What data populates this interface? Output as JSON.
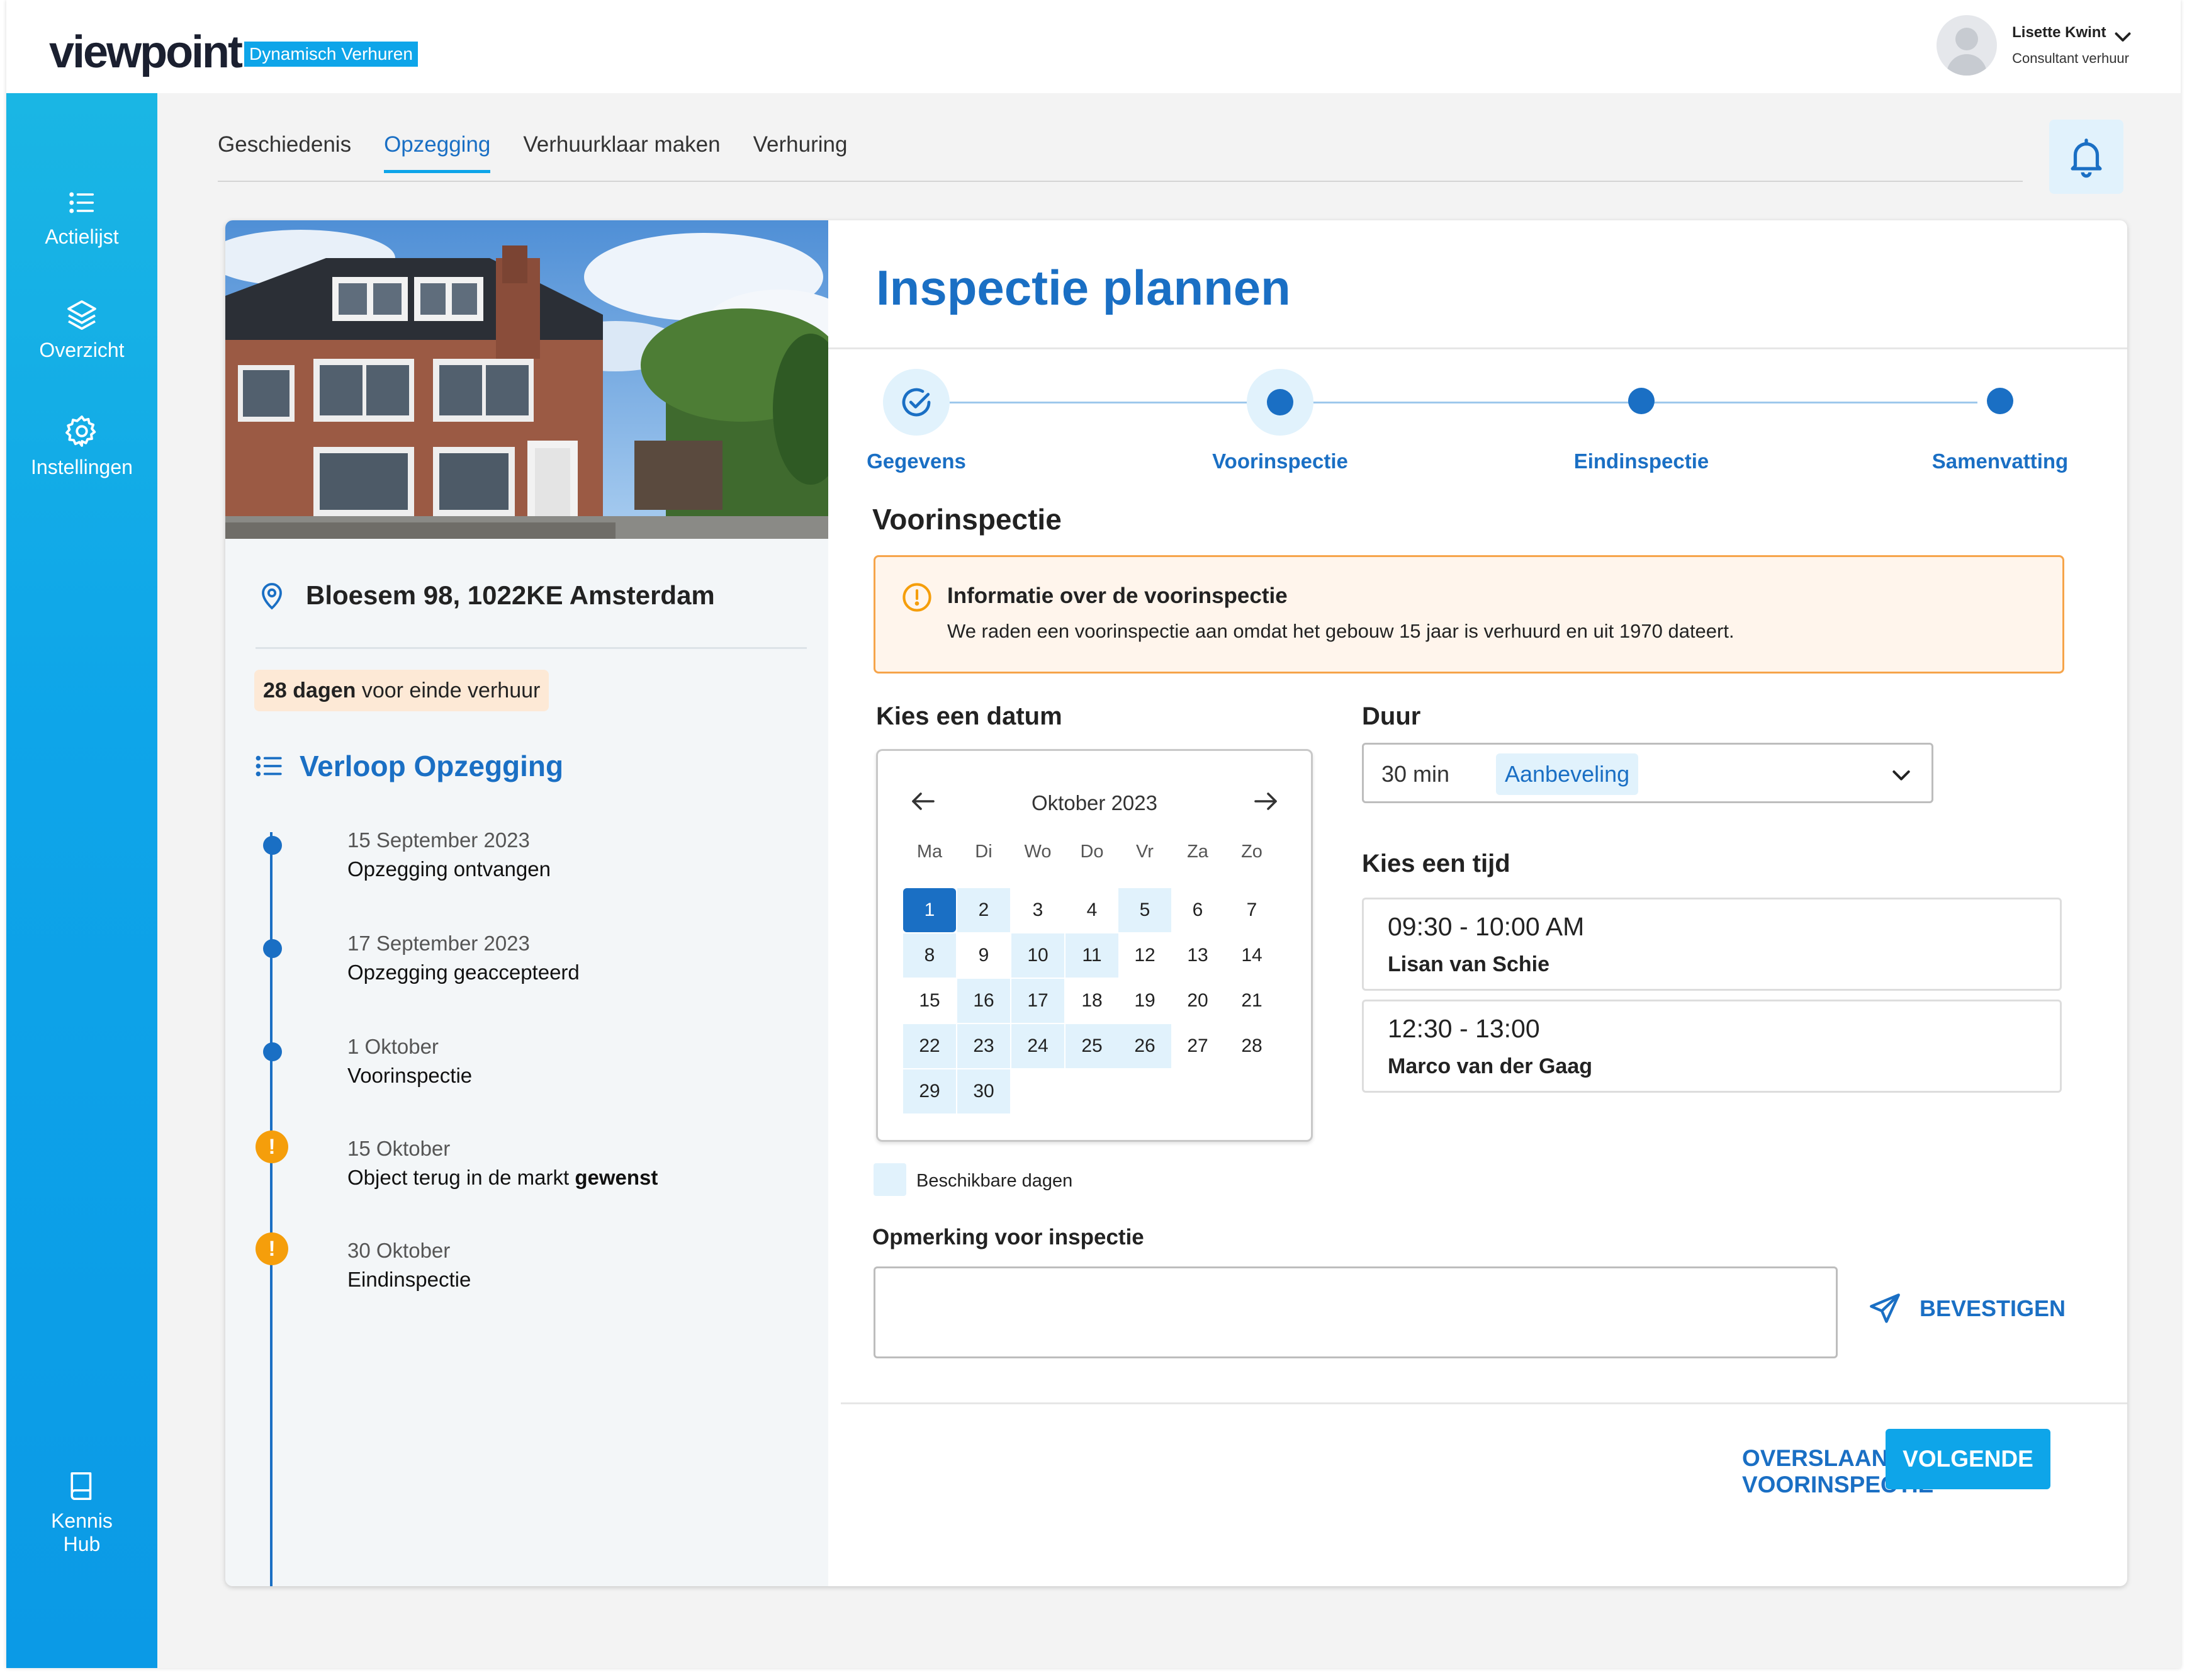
{
  "brand": {
    "logo": "viewpoint",
    "product": "Dynamisch Verhuren",
    "accent": "#0ea5e9",
    "primary": "#1a6fc4"
  },
  "user": {
    "name": "Lisette Kwint",
    "role": "Consultant verhuur",
    "menu_icon": "chevron-down-icon"
  },
  "sidebar": {
    "items": [
      {
        "label": "Actielijst",
        "icon": "list-icon"
      },
      {
        "label": "Overzicht",
        "icon": "layers-icon"
      },
      {
        "label": "Instellingen",
        "icon": "gear-icon"
      }
    ],
    "bottom": {
      "label_line1": "Kennis",
      "label_line2": "Hub",
      "icon": "book-icon"
    }
  },
  "tabs": [
    {
      "label": "Geschiedenis",
      "active": false
    },
    {
      "label": "Opzegging",
      "active": true
    },
    {
      "label": "Verhuurklaar maken",
      "active": false
    },
    {
      "label": "Verhuring",
      "active": false
    }
  ],
  "property": {
    "address": "Bloesem 98, 1022KE Amsterdam",
    "days_strong": "28 dagen",
    "days_rest": " voor einde verhuur",
    "timeline_title": "Verloop Opzegging",
    "timeline": [
      {
        "date": "15 September 2023",
        "text": "Opzegging ontvangen",
        "strong": "",
        "status": "done"
      },
      {
        "date": "17 September 2023",
        "text": "Opzegging geaccepteerd",
        "strong": "",
        "status": "done"
      },
      {
        "date": "1 Oktober",
        "text": "Voorinspectie",
        "strong": "",
        "status": "done"
      },
      {
        "date": "15 Oktober",
        "text": "Object terug in de markt ",
        "strong": "gewenst",
        "status": "warning"
      },
      {
        "date": "30 Oktober",
        "text": "Eindinspectie",
        "strong": "",
        "status": "warning"
      }
    ]
  },
  "panel": {
    "title": "Inspectie plannen",
    "steps": [
      {
        "label": "Gegevens",
        "state": "completed"
      },
      {
        "label": "Voorinspectie",
        "state": "current"
      },
      {
        "label": "Eindinspectie",
        "state": "upcoming"
      },
      {
        "label": "Samenvatting",
        "state": "upcoming"
      }
    ],
    "section_title": "Voorinspectie",
    "alert": {
      "title": "Informatie over de voorinspectie",
      "text": "We raden een voorinspectie aan omdat het gebouw 15 jaar is verhuurd en uit 1970 dateert."
    },
    "date_label": "Kies een datum",
    "calendar": {
      "month": "Oktober 2023",
      "weekdays": [
        "Ma",
        "Di",
        "Wo",
        "Do",
        "Vr",
        "Za",
        "Zo"
      ],
      "selected": 1,
      "available": [
        1,
        2,
        5,
        8,
        10,
        11,
        16,
        17,
        22,
        23,
        24,
        25,
        26,
        29,
        30
      ],
      "days": 30
    },
    "legend": "Beschikbare dagen",
    "duration_label": "Duur",
    "duration_value": "30 min",
    "duration_chip": "Aanbeveling",
    "time_label": "Kies een tijd",
    "timeslots": [
      {
        "time": "09:30 - 10:00 AM",
        "person": "Lisan van Schie"
      },
      {
        "time": "12:30 - 13:00",
        "person": "Marco van der Gaag"
      }
    ],
    "remark_label": "Opmerking voor inspectie",
    "remark_value": "",
    "confirm_label": "BEVESTIGEN",
    "skip_label": "OVERSLAAN VAN VOORINSPECTIE",
    "next_label": "VOLGENDE"
  }
}
